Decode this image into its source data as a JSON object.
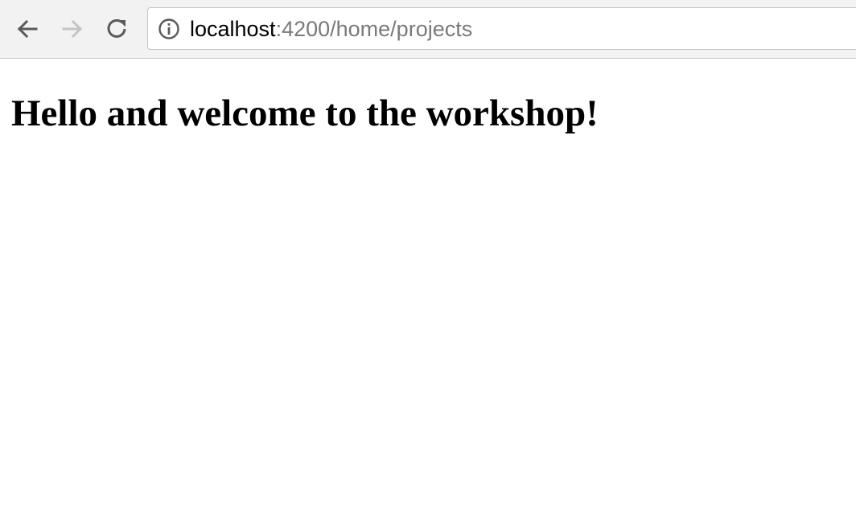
{
  "toolbar": {
    "back_icon": "back-arrow-icon",
    "forward_icon": "forward-arrow-icon",
    "reload_icon": "reload-icon"
  },
  "address_bar": {
    "security_icon": "info-icon",
    "url_host": "localhost",
    "url_rest": ":4200/home/projects"
  },
  "page": {
    "heading": "Hello and welcome to the workshop!"
  },
  "colors": {
    "toolbar_bg": "#f2f2f2",
    "url_host": "#000000",
    "url_rest": "#7a7a7a",
    "forward_disabled": "#c4c4c4",
    "icon": "#5a5a5a"
  }
}
